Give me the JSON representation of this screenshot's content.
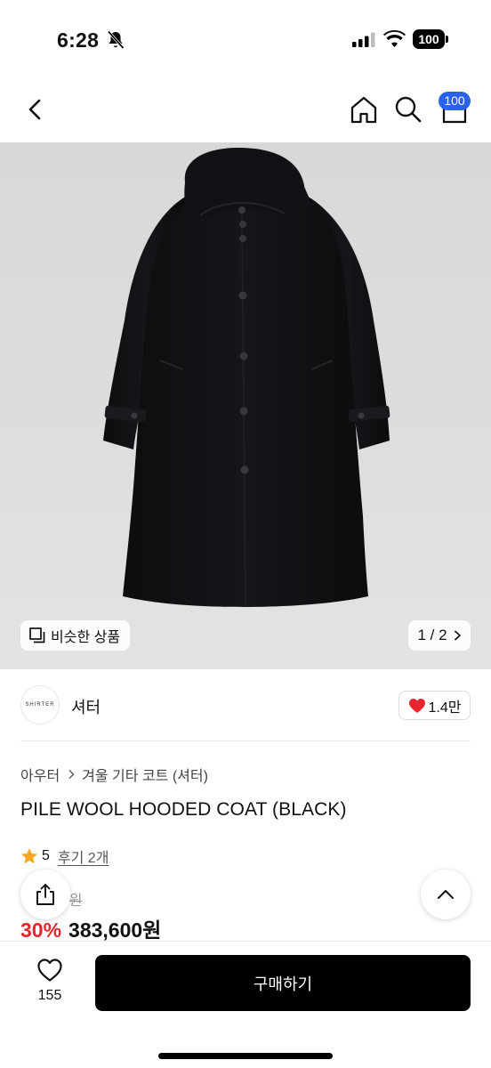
{
  "status_bar": {
    "time": "6:28",
    "battery": "100"
  },
  "nav": {
    "cart_count": "100",
    "icons": [
      "back-arrow-icon",
      "home-icon",
      "search-icon",
      "shopping-bag-icon"
    ]
  },
  "image": {
    "similar_label": "비슷한 상품",
    "pager": "1 / 2"
  },
  "shop": {
    "logo_text": "SHIRTER",
    "name": "셔터",
    "likes": "1.4만"
  },
  "product": {
    "breadcrumb": [
      "아우터",
      "겨울 기타 코트 (셔터)"
    ],
    "title": "PILE WOOL HOODED COAT (BLACK)",
    "rating": "5",
    "reviews": "후기 2개",
    "original_price": "00원",
    "discount": "30%",
    "price": "383,600원"
  },
  "bottom": {
    "wish_count": "155",
    "buy_label": "구매하기"
  },
  "colors": {
    "accent_blue": "#2a62f0",
    "discount_red": "#e8242e",
    "heart_red": "#e8242e",
    "star": "#f5a623"
  }
}
